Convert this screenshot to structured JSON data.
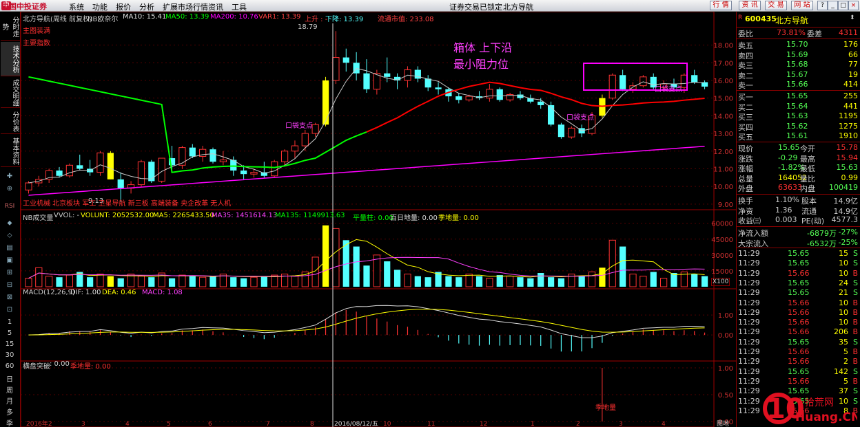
{
  "menubar": {
    "logo": "中国中投证券",
    "items": [
      "系统",
      "功能",
      "报价",
      "分析",
      "扩展市场行情",
      "资讯",
      "工具"
    ],
    "status": "证券交易已锁定",
    "stock": "北方导航",
    "buttons": [
      "行 情",
      "资 讯",
      "交 易",
      "网 站"
    ],
    "window_buttons": [
      "?",
      "_",
      "□",
      "×"
    ]
  },
  "lefttabs": {
    "tabs": [
      "分时走势",
      "技术分析",
      "成交明细",
      "分价表",
      "基本资料"
    ],
    "icons": [
      "✚",
      "⊕",
      "RSI",
      "⬥",
      "⬦",
      "▤",
      "▣",
      "⊞",
      "⊟",
      "⊠",
      "⊡",
      "⊙"
    ],
    "periods": [
      "1",
      "5",
      "15",
      "30",
      "60",
      "日",
      "周",
      "月",
      "多",
      "季",
      "年"
    ]
  },
  "main_chart": {
    "header": {
      "title": "北方导航(周线 前复权)",
      "indicator": "NB欧奈尔",
      "ma10": "MA10: 15.41",
      "ma50": "MA50: 13.39",
      "ma200": "MA200: 10.76",
      "var1": "VAR1: 13.39",
      "up": "上升 : -",
      "down": "下降: 13.39",
      "mktcap": "流通市值: 233.08"
    },
    "label_main": "主图装满",
    "label_sub": "主要指数",
    "annotation_line1": "箱体 上下沿",
    "annotation_line2": "最小阻力位",
    "high_label": "18.79",
    "low_label": "9.13",
    "pivot_labels": [
      "口袋支点",
      "口袋支点",
      "口袋支点"
    ],
    "concepts": "工业机械 北京板块 军工 卫星导航 新三板 高端装备 央企改革 无人机",
    "y_ticks": [
      "18.00",
      "17.00",
      "16.00",
      "15.00",
      "14.00",
      "13.00",
      "12.00",
      "11.00",
      "10.00",
      "9.00"
    ]
  },
  "volume_chart": {
    "header": {
      "name": "NB成交量",
      "vvol": "VVOL: -",
      "volunt": "VOLUNT: 2052532.00",
      "ma5": "MA5: 2265433.50",
      "ma35": "MA35: 1451614.13",
      "ma135": "MA135: 1149913.63",
      "pingliang": "平量柱: 0.00",
      "bairi": "百日地量: 0.00",
      "jidi": "季地量: 0.00"
    },
    "y_ticks": [
      "60000",
      "45000",
      "30000",
      "15000"
    ],
    "unit": "X100"
  },
  "macd_chart": {
    "header": {
      "name": "MACD(12,26,9)",
      "dif": "DIF: 1.00",
      "dea": "DEA: 0.46",
      "macd": "MACD: 1.08"
    },
    "y_ticks": [
      "1.00",
      "0.00"
    ]
  },
  "breakout_chart": {
    "header": {
      "name": "横盘突破",
      "val": ": 0.00",
      "jidi": "季地量: 0.00"
    },
    "label": "季地量",
    "y_ticks": [
      "1.00",
      "0.50",
      "0.00"
    ]
  },
  "xaxis": {
    "labels": [
      "2016年2",
      "3",
      "4",
      "5",
      "6",
      "7",
      "8",
      "2016/08/12/五",
      "10",
      "11",
      "12",
      "1",
      "2",
      "3",
      "4"
    ],
    "end": "图地"
  },
  "quote": {
    "code": "600435",
    "name": "北方导航",
    "weibi_label": "委比",
    "weibi": "73.81%",
    "weicha_label": "委差",
    "weicha": "4311",
    "asks": [
      {
        "label": "卖五",
        "price": "15.70",
        "vol": "176"
      },
      {
        "label": "卖四",
        "price": "15.69",
        "vol": "66"
      },
      {
        "label": "卖三",
        "price": "15.68",
        "vol": "77"
      },
      {
        "label": "卖二",
        "price": "15.67",
        "vol": "19"
      },
      {
        "label": "卖一",
        "price": "15.66",
        "vol": "414"
      }
    ],
    "bids": [
      {
        "label": "买一",
        "price": "15.65",
        "vol": "255"
      },
      {
        "label": "买二",
        "price": "15.64",
        "vol": "441"
      },
      {
        "label": "买三",
        "price": "15.63",
        "vol": "1195"
      },
      {
        "label": "买四",
        "price": "15.62",
        "vol": "1275"
      },
      {
        "label": "买五",
        "price": "15.61",
        "vol": "1910"
      }
    ],
    "stats": [
      {
        "l1": "现价",
        "v1": "15.65",
        "l2": "今开",
        "v2": "15.78"
      },
      {
        "l1": "涨跌",
        "v1": "-0.29",
        "l2": "最高",
        "v2": "15.94"
      },
      {
        "l1": "涨幅",
        "v1": "-1.82%",
        "l2": "最低",
        "v2": "15.63"
      },
      {
        "l1": "总量",
        "v1": "164052",
        "l2": "量比",
        "v2": "0.99"
      },
      {
        "l1": "外盘",
        "v1": "63633",
        "l2": "内盘",
        "v2": "100419"
      }
    ],
    "stats2": [
      {
        "l1": "换手",
        "v1": "1.10%",
        "l2": "股本",
        "v2": "14.9亿"
      },
      {
        "l1": "净资",
        "v1": "1.36",
        "l2": "流通",
        "v2": "14.9亿"
      },
      {
        "l1": "收益㈢",
        "v1": "0.003",
        "l2": "PE(动)",
        "v2": "4577.3"
      }
    ],
    "flows": [
      {
        "label": "净流入额",
        "val": "-6879万",
        "pct": "-27%"
      },
      {
        "label": "大宗流入",
        "val": "-6532万",
        "pct": "-25%"
      }
    ],
    "ticks": [
      {
        "t": "11:29",
        "p": "15.65",
        "v": "15",
        "s": "S"
      },
      {
        "t": "11:29",
        "p": "15.65",
        "v": "10",
        "s": "S"
      },
      {
        "t": "11:29",
        "p": "15.66",
        "v": "10",
        "s": "B"
      },
      {
        "t": "11:29",
        "p": "15.65",
        "v": "24",
        "s": "S"
      },
      {
        "t": "11:29",
        "p": "15.65",
        "v": "21",
        "s": "S"
      },
      {
        "t": "11:29",
        "p": "15.66",
        "v": "10",
        "s": "B"
      },
      {
        "t": "11:29",
        "p": "15.66",
        "v": "10",
        "s": "B"
      },
      {
        "t": "11:29",
        "p": "15.66",
        "v": "10",
        "s": "B"
      },
      {
        "t": "11:29",
        "p": "15.66",
        "v": "206",
        "s": "B"
      },
      {
        "t": "11:29",
        "p": "15.65",
        "v": "35",
        "s": "S"
      },
      {
        "t": "11:29",
        "p": "15.66",
        "v": "5",
        "s": "B"
      },
      {
        "t": "11:29",
        "p": "15.66",
        "v": "2",
        "s": "B"
      },
      {
        "t": "11:29",
        "p": "15.65",
        "v": "142",
        "s": "S"
      },
      {
        "t": "11:29",
        "p": "15.66",
        "v": "5",
        "s": "B"
      },
      {
        "t": "11:29",
        "p": "15.65",
        "v": "37",
        "s": "S"
      },
      {
        "t": "11:29",
        "p": "15.65",
        "v": "10",
        "s": "S"
      },
      {
        "t": "11:29",
        "p": "15.66",
        "v": "8",
        "s": "B"
      }
    ]
  },
  "watermark": {
    "text": "10",
    "sub": "Huang.CN",
    "cn": "十拾荒网"
  },
  "colors": {
    "up": "#ff3232",
    "down": "#54ffff",
    "ma10": "#c8c8c8",
    "ma50": "#00ff00",
    "ma50b": "#ff0000",
    "ma200": "#ff00ff",
    "yellow": "#ffff00",
    "box": "#ff00ff"
  },
  "chart_data": {
    "type": "candlestick",
    "period": "weekly",
    "ylim": [
      8.8,
      18.8
    ],
    "candles": [
      [
        9.8,
        10.3,
        9.6,
        10.2
      ],
      [
        10.2,
        10.6,
        10.0,
        10.4
      ],
      [
        10.4,
        11.0,
        10.2,
        10.9
      ],
      [
        10.9,
        11.1,
        10.5,
        10.6
      ],
      [
        10.6,
        11.3,
        10.5,
        11.2
      ],
      [
        11.2,
        11.8,
        10.9,
        11.0
      ],
      [
        11.0,
        11.5,
        10.6,
        10.8
      ],
      [
        10.8,
        12.0,
        10.6,
        11.9
      ],
      [
        11.9,
        12.0,
        10.4,
        10.4
      ],
      [
        10.4,
        10.8,
        9.13,
        9.9
      ],
      [
        9.9,
        10.3,
        9.6,
        10.1
      ],
      [
        10.1,
        11.5,
        10.0,
        11.4
      ],
      [
        11.4,
        11.5,
        10.2,
        10.3
      ],
      [
        10.3,
        11.6,
        10.2,
        11.6
      ],
      [
        11.6,
        12.3,
        11.0,
        11.2
      ],
      [
        11.2,
        12.3,
        11.0,
        12.2
      ],
      [
        12.2,
        12.4,
        11.6,
        11.7
      ],
      [
        11.7,
        12.3,
        11.4,
        12.1
      ],
      [
        12.1,
        12.2,
        11.3,
        11.4
      ],
      [
        11.4,
        12.0,
        11.2,
        11.5
      ],
      [
        11.5,
        11.7,
        10.6,
        10.9
      ],
      [
        10.9,
        11.2,
        10.4,
        10.7
      ],
      [
        10.7,
        11.0,
        10.5,
        10.8
      ],
      [
        10.8,
        11.4,
        10.5,
        10.6
      ],
      [
        10.6,
        11.5,
        10.5,
        11.4
      ],
      [
        11.4,
        12.1,
        11.2,
        12.0
      ],
      [
        12.0,
        12.6,
        11.6,
        12.3
      ],
      [
        12.3,
        13.2,
        12.0,
        13.0
      ],
      [
        13.0,
        13.6,
        12.8,
        13.5
      ],
      [
        13.5,
        16.2,
        13.4,
        16.0
      ],
      [
        16.0,
        18.79,
        15.8,
        17.3
      ],
      [
        17.3,
        17.8,
        16.5,
        17.0
      ],
      [
        17.0,
        17.6,
        16.0,
        16.4
      ],
      [
        16.4,
        17.2,
        15.3,
        15.5
      ],
      [
        15.5,
        16.6,
        15.2,
        16.4
      ],
      [
        16.4,
        17.3,
        15.9,
        16.2
      ],
      [
        16.2,
        16.4,
        15.5,
        16.0
      ],
      [
        16.0,
        16.8,
        15.6,
        16.6
      ],
      [
        16.6,
        16.8,
        15.9,
        16.1
      ],
      [
        16.1,
        16.3,
        15.4,
        15.6
      ],
      [
        15.6,
        15.9,
        15.2,
        15.5
      ],
      [
        15.5,
        15.6,
        14.8,
        15.1
      ],
      [
        15.1,
        15.3,
        14.7,
        14.9
      ],
      [
        14.9,
        15.2,
        14.8,
        15.1
      ],
      [
        15.1,
        15.4,
        14.9,
        15.0
      ],
      [
        15.0,
        15.8,
        14.8,
        15.5
      ],
      [
        15.5,
        15.6,
        14.8,
        14.9
      ],
      [
        14.9,
        15.3,
        14.8,
        15.2
      ],
      [
        15.2,
        15.4,
        14.9,
        15.0
      ],
      [
        15.0,
        15.2,
        14.7,
        14.8
      ],
      [
        14.8,
        15.0,
        14.4,
        14.6
      ],
      [
        14.6,
        14.8,
        13.4,
        13.5
      ],
      [
        13.5,
        13.6,
        12.7,
        12.8
      ],
      [
        12.8,
        13.4,
        12.7,
        13.3
      ],
      [
        13.3,
        13.5,
        12.8,
        13.0
      ],
      [
        13.0,
        14.2,
        12.9,
        14.0
      ],
      [
        14.0,
        15.2,
        13.9,
        15.0
      ],
      [
        15.0,
        16.4,
        14.9,
        16.3
      ],
      [
        16.3,
        16.6,
        15.4,
        15.5
      ],
      [
        15.5,
        15.9,
        15.3,
        15.7
      ],
      [
        15.7,
        16.3,
        15.6,
        16.2
      ],
      [
        16.2,
        16.4,
        15.5,
        15.6
      ],
      [
        15.6,
        16.0,
        15.4,
        15.8
      ],
      [
        15.8,
        16.1,
        15.5,
        15.6
      ],
      [
        15.6,
        16.4,
        15.3,
        16.3
      ],
      [
        16.3,
        16.6,
        15.8,
        15.9
      ],
      [
        15.9,
        16.0,
        15.5,
        15.65
      ]
    ],
    "volume": [
      8,
      18,
      10,
      9,
      11,
      14,
      9,
      12,
      10,
      8,
      12,
      10,
      9,
      13,
      8,
      11,
      10,
      9,
      10,
      12,
      9,
      8,
      9,
      10,
      11,
      12,
      10,
      14,
      28,
      58,
      55,
      44,
      38,
      20,
      30,
      24,
      16,
      12,
      10,
      9,
      14,
      10,
      9,
      12,
      10,
      8,
      11,
      10,
      9,
      8,
      13,
      9,
      8,
      12,
      10,
      14,
      18,
      44,
      38,
      12,
      10,
      14,
      8,
      13,
      14,
      12,
      10
    ],
    "macd_range": [
      -1.2,
      2.0
    ]
  }
}
